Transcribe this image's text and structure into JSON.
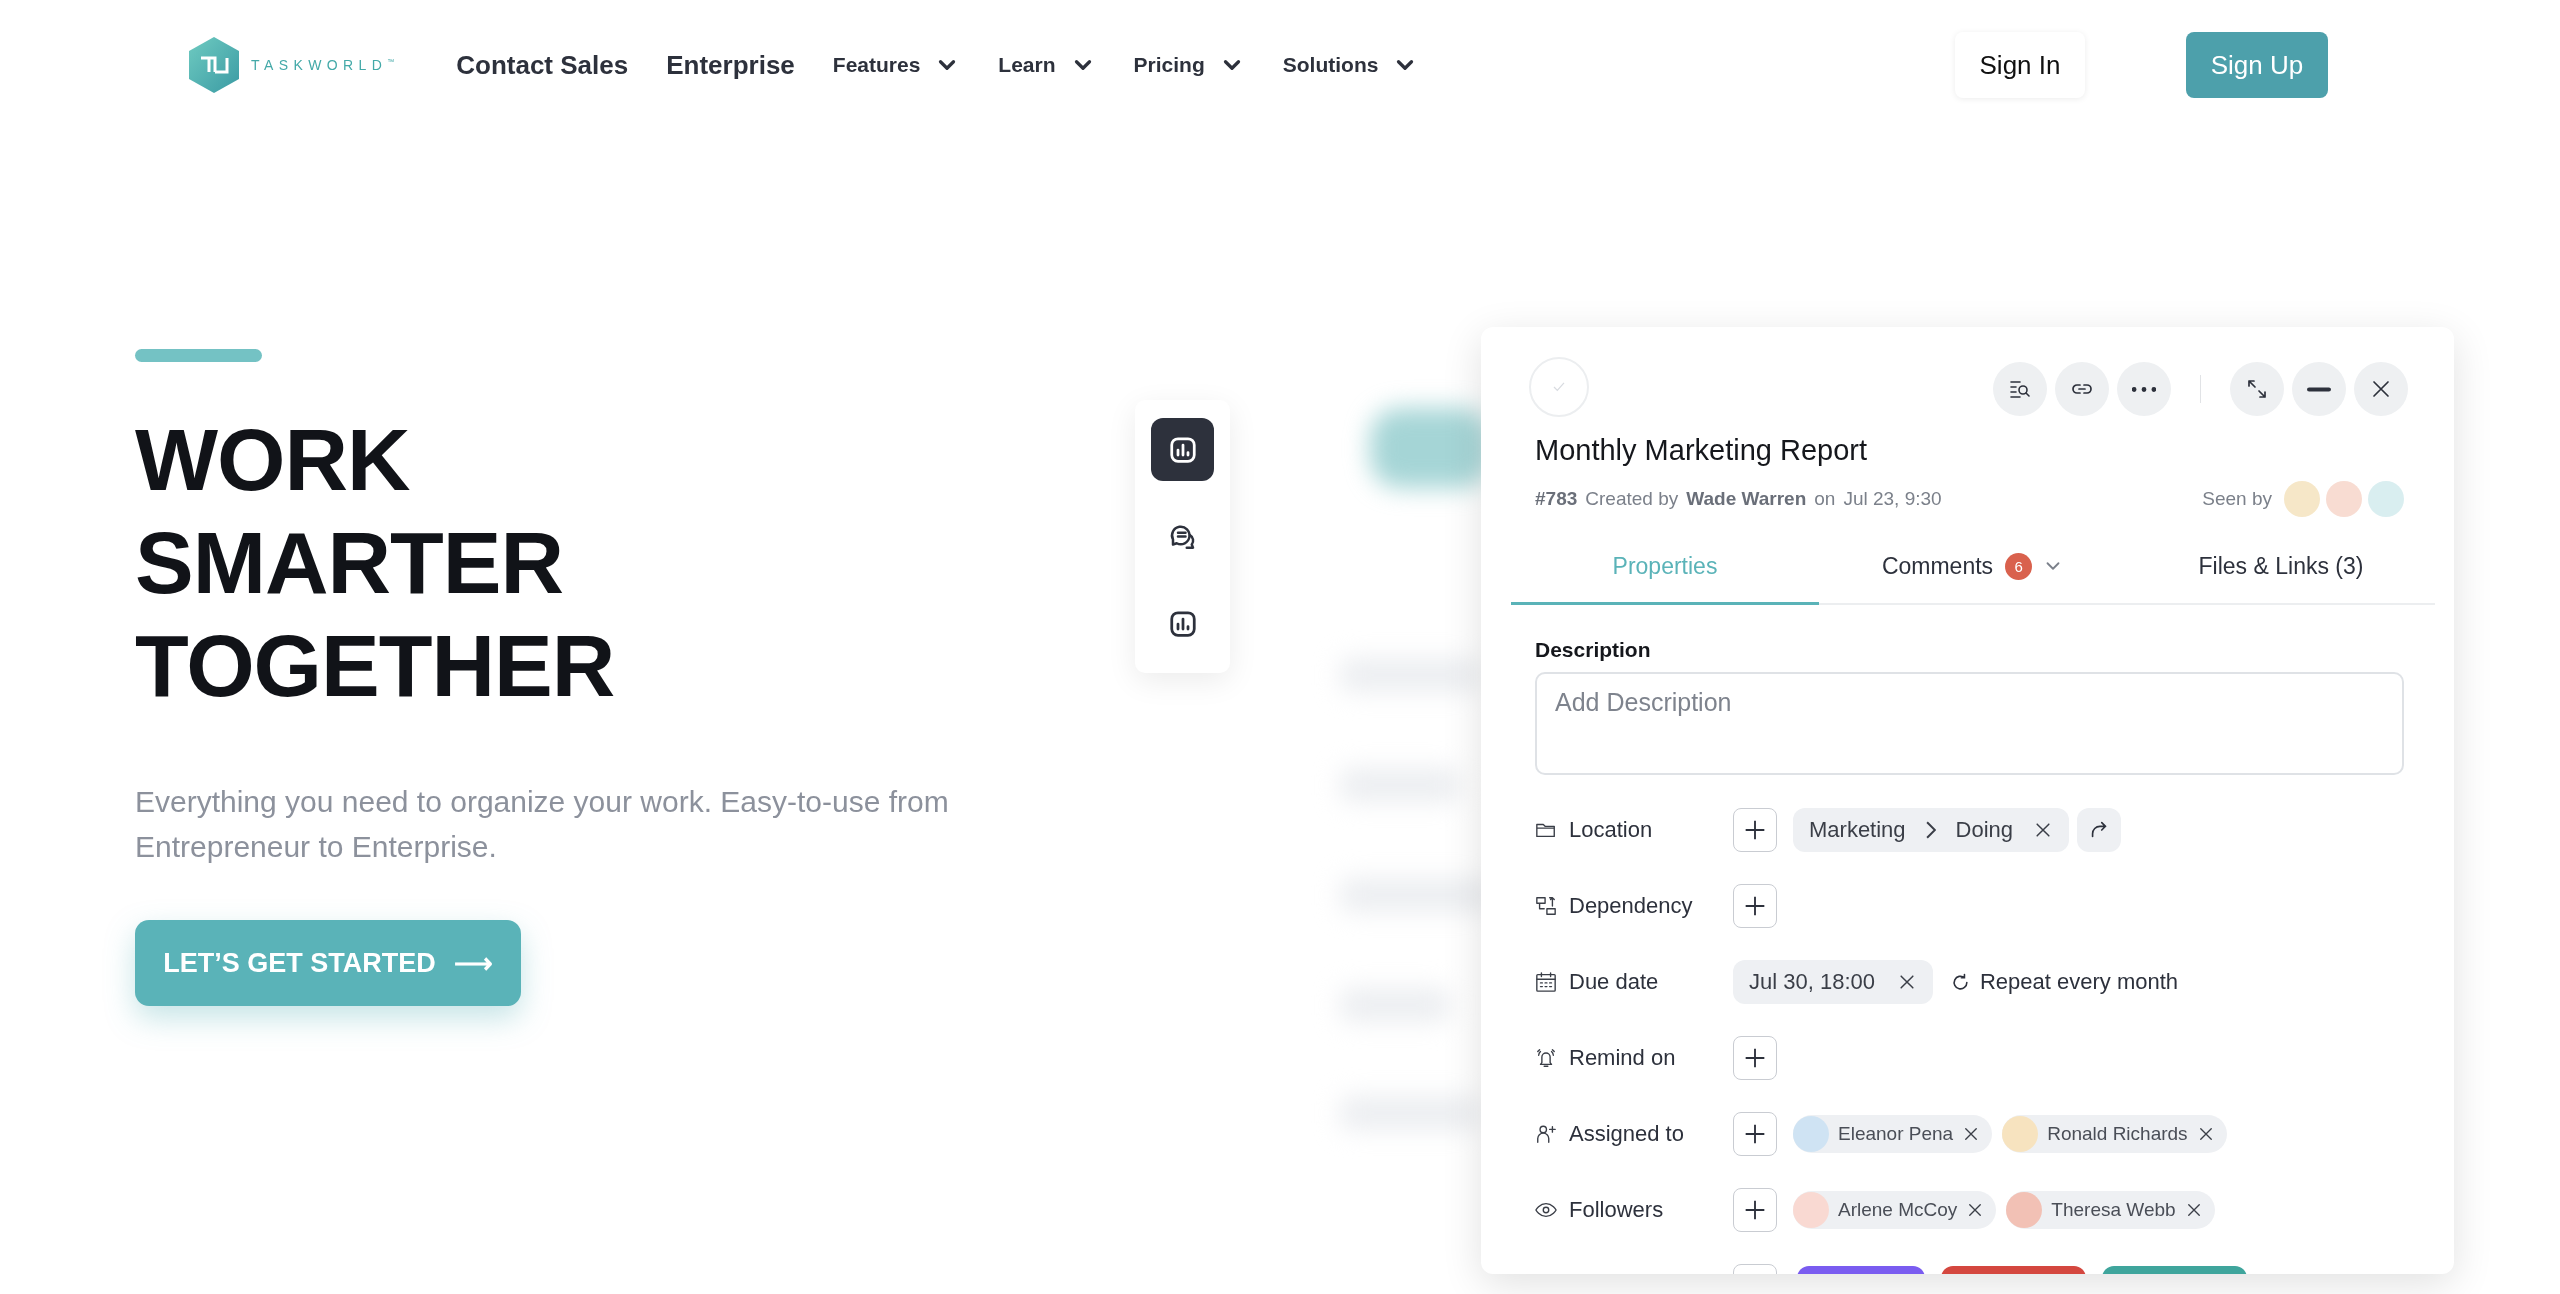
{
  "header": {
    "logo": "TASKWORLD",
    "trademark": "™",
    "nav": [
      {
        "label": "Contact Sales",
        "kind": "primary",
        "dropdown": false
      },
      {
        "label": "Enterprise",
        "kind": "primary",
        "dropdown": false
      },
      {
        "label": "Features",
        "kind": "menu",
        "dropdown": true
      },
      {
        "label": "Learn",
        "kind": "menu",
        "dropdown": true
      },
      {
        "label": "Pricing",
        "kind": "menu",
        "dropdown": true
      },
      {
        "label": "Solutions",
        "kind": "menu",
        "dropdown": true
      }
    ],
    "sign_in": "Sign In",
    "sign_up": "Sign Up"
  },
  "hero": {
    "headline": [
      "WORK",
      "SMARTER",
      "TOGETHER"
    ],
    "subtitle": "Everything you need to organize your work. Easy-to-use from Entrepreneur to Enterprise.",
    "cta": "LET’S GET STARTED",
    "cta_arrow": "⟶"
  },
  "side_toolbar": [
    {
      "kind": "chart",
      "selected": true
    },
    {
      "kind": "chat",
      "selected": false
    },
    {
      "kind": "chart",
      "selected": false
    }
  ],
  "task": {
    "completed": false,
    "actions": [
      {
        "kind": "search-list"
      },
      {
        "kind": "link"
      },
      {
        "kind": "more"
      }
    ],
    "window_actions": [
      {
        "kind": "expand"
      },
      {
        "kind": "minimize"
      },
      {
        "kind": "close"
      }
    ],
    "title": "Monthly Marketing Report",
    "number": "#783",
    "created_by_label": "Created by",
    "author": "Wade Warren",
    "on_label": "on",
    "created_at": "Jul 23, 9:30",
    "seen_by_label": "Seen by",
    "seen_by": [
      {
        "color": "#f6e7c8"
      },
      {
        "color": "#f8dcd2"
      },
      {
        "color": "#d9eef0"
      }
    ],
    "tabs": [
      {
        "label": "Properties",
        "selected": true
      },
      {
        "label": "Comments",
        "badge": "6",
        "dropdown": true,
        "selected": false
      },
      {
        "label": "Files & Links (3)",
        "selected": false
      }
    ],
    "description": {
      "label": "Description",
      "placeholder": "Add Description"
    },
    "properties": [
      {
        "kind": "location",
        "label": "Location",
        "path": [
          "Marketing",
          "Doing"
        ]
      },
      {
        "kind": "dependency",
        "label": "Dependency"
      },
      {
        "kind": "due_date",
        "label": "Due date",
        "value": "Jul 30, 18:00",
        "repeat": "Repeat every month"
      },
      {
        "kind": "reminder",
        "label": "Remind on"
      },
      {
        "kind": "assignees",
        "label": "Assigned to",
        "people": [
          {
            "name": "Eleanor Pena",
            "color": "#cfe3f3"
          },
          {
            "name": "Ronald Richards",
            "color": "#f7e3bf"
          }
        ]
      },
      {
        "kind": "followers",
        "label": "Followers",
        "people": [
          {
            "name": "Arlene McCoy",
            "color": "#f9d9d2"
          },
          {
            "name": "Theresa Webb",
            "color": "#f2c1b5"
          }
        ]
      },
      {
        "kind": "tags",
        "tags": [
          {
            "color": "#7a5cf0"
          },
          {
            "color": "#d4473f"
          },
          {
            "color": "#3fa59c"
          }
        ]
      }
    ]
  }
}
